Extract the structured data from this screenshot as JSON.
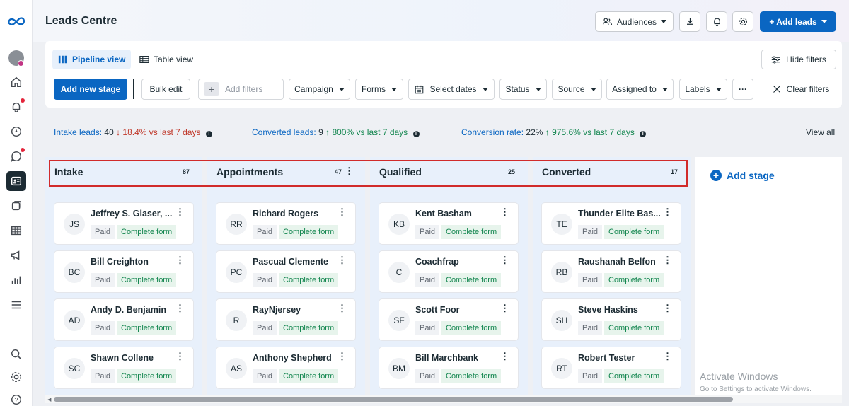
{
  "header": {
    "title": "Leads Centre",
    "audiences_label": "Audiences",
    "add_leads_label": "+ Add leads"
  },
  "views": {
    "pipeline": "Pipeline view",
    "table": "Table view",
    "hide_filters": "Hide filters"
  },
  "toolbar": {
    "add_new_stage": "Add new stage",
    "bulk_edit": "Bulk edit",
    "add_filters_placeholder": "Add filters",
    "campaign": "Campaign",
    "forms": "Forms",
    "select_dates": "Select dates",
    "status": "Status",
    "source": "Source",
    "assigned_to": "Assigned to",
    "labels": "Labels",
    "more": "···",
    "clear_filters": "Clear filters"
  },
  "stats": {
    "intake_label": "Intake leads:",
    "intake_value": "40",
    "intake_change": "↓ 18.4% vs last 7 days",
    "converted_label": "Converted leads:",
    "converted_value": "9",
    "converted_change": "↑ 800% vs last 7 days",
    "conversion_label": "Conversion rate:",
    "conversion_value": "22%",
    "conversion_change": "↑ 975.6% vs last 7 days",
    "view_all": "View all"
  },
  "stages": [
    {
      "title": "Intake",
      "count": "87",
      "cards": [
        {
          "initials": "JS",
          "name": "Jeffrey S. Glaser, ...",
          "tag1": "Paid",
          "tag2": "Complete form"
        },
        {
          "initials": "BC",
          "name": "Bill Creighton",
          "tag1": "Paid",
          "tag2": "Complete form"
        },
        {
          "initials": "AD",
          "name": "Andy D. Benjamin",
          "tag1": "Paid",
          "tag2": "Complete form"
        },
        {
          "initials": "SC",
          "name": "Shawn Collene",
          "tag1": "Paid",
          "tag2": "Complete form"
        }
      ]
    },
    {
      "title": "Appointments",
      "count": "47",
      "cards": [
        {
          "initials": "RR",
          "name": "Richard Rogers",
          "tag1": "Paid",
          "tag2": "Complete form"
        },
        {
          "initials": "PC",
          "name": "Pascual Clemente",
          "tag1": "Paid",
          "tag2": "Complete form"
        },
        {
          "initials": "R",
          "name": "RayNjersey",
          "tag1": "Paid",
          "tag2": "Complete form"
        },
        {
          "initials": "AS",
          "name": "Anthony Shepherd",
          "tag1": "Paid",
          "tag2": "Complete form"
        }
      ]
    },
    {
      "title": "Qualified",
      "count": "25",
      "cards": [
        {
          "initials": "KB",
          "name": "Kent Basham",
          "tag1": "Paid",
          "tag2": "Complete form"
        },
        {
          "initials": "C",
          "name": "Coachfrap",
          "tag1": "Paid",
          "tag2": "Complete form"
        },
        {
          "initials": "SF",
          "name": "Scott Foor",
          "tag1": "Paid",
          "tag2": "Complete form"
        },
        {
          "initials": "BM",
          "name": "Bill Marchbank",
          "tag1": "Paid",
          "tag2": "Complete form"
        }
      ]
    },
    {
      "title": "Converted",
      "count": "17",
      "cards": [
        {
          "initials": "TE",
          "name": "Thunder Elite Bas...",
          "tag1": "Paid",
          "tag2": "Complete form"
        },
        {
          "initials": "RB",
          "name": "Raushanah Belfon",
          "tag1": "Paid",
          "tag2": "Complete form"
        },
        {
          "initials": "SH",
          "name": "Steve Haskins",
          "tag1": "Paid",
          "tag2": "Complete form"
        },
        {
          "initials": "RT",
          "name": "Robert Tester",
          "tag1": "Paid",
          "tag2": "Complete form"
        }
      ]
    }
  ],
  "add_stage_label": "Add stage",
  "watermark": {
    "line1": "Activate Windows",
    "line2": "Go to Settings to activate Windows."
  },
  "colors": {
    "accent": "#0a66c2",
    "positive": "#13864f",
    "negative": "#c0392b",
    "highlight": "#d12b2b"
  }
}
